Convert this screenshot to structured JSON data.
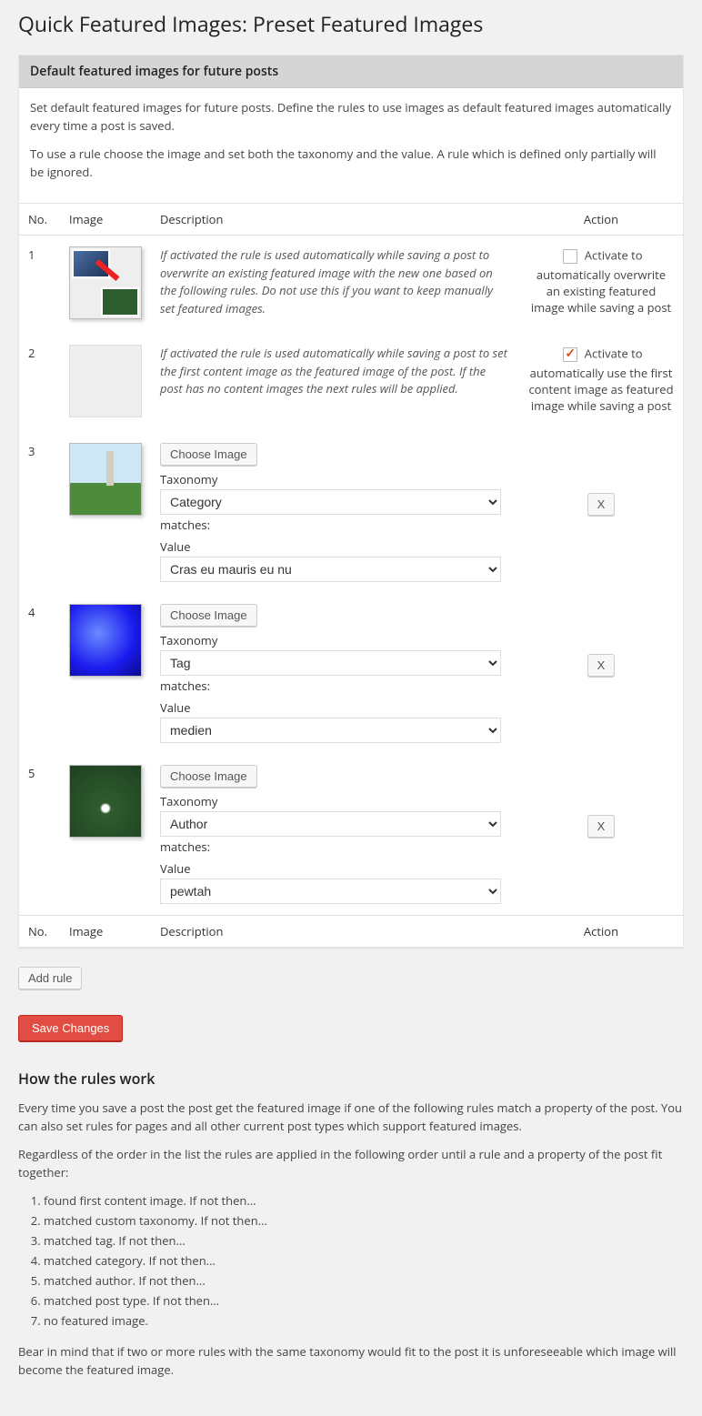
{
  "page_title": "Quick Featured Images: Preset Featured Images",
  "panel_header": "Default featured images for future posts",
  "intro_p1": "Set default featured images for future posts. Define the rules to use images as default featured images automatically every time a post is saved.",
  "intro_p2": "To use a rule choose the image and set both the taxonomy and the value. A rule which is defined only partially will be ignored.",
  "cols": {
    "no": "No.",
    "image": "Image",
    "description": "Description",
    "action": "Action"
  },
  "rows": {
    "r1": {
      "no": "1",
      "desc": "If activated the rule is used automatically while saving a post to overwrite an existing featured image with the new one based on the following rules. Do not use this if you want to keep manually set featured images.",
      "action": "Activate to automatically overwrite an existing featured image while saving a post",
      "checked": false
    },
    "r2": {
      "no": "2",
      "desc": "If activated the rule is used automatically while saving a post to set the first content image as the featured image of the post. If the post has no content images the next rules will be applied.",
      "action": "Activate to automatically use the first content image as featured image while saving a post",
      "checked": true
    },
    "r3": {
      "no": "3",
      "choose": "Choose Image",
      "taxonomy_label": "Taxonomy",
      "taxonomy_value": "Category",
      "matches": "matches:",
      "value_label": "Value",
      "value_value": "Cras eu mauris eu nu",
      "remove": "X"
    },
    "r4": {
      "no": "4",
      "choose": "Choose Image",
      "taxonomy_label": "Taxonomy",
      "taxonomy_value": "Tag",
      "matches": "matches:",
      "value_label": "Value",
      "value_value": "medien",
      "remove": "X"
    },
    "r5": {
      "no": "5",
      "choose": "Choose Image",
      "taxonomy_label": "Taxonomy",
      "taxonomy_value": "Author",
      "matches": "matches:",
      "value_label": "Value",
      "value_value": "pewtah",
      "remove": "X"
    }
  },
  "add_rule": "Add rule",
  "save_changes": "Save Changes",
  "how_heading": "How the rules work",
  "how_p1": "Every time you save a post the post get the featured image if one of the following rules match a property of the post. You can also set rules for pages and all other current post types which support featured images.",
  "how_p2": "Regardless of the order in the list the rules are applied in the following order until a rule and a property of the post fit together:",
  "order": {
    "i1": "found first content image. If not then...",
    "i2": "matched custom taxonomy. If not then...",
    "i3": "matched tag. If not then...",
    "i4": "matched category. If not then...",
    "i5": "matched author. If not then...",
    "i6": "matched post type. If not then...",
    "i7": "no featured image."
  },
  "how_p3": "Bear in mind that if two or more rules with the same taxonomy would fit to the post it is unforeseeable which image will become the featured image."
}
